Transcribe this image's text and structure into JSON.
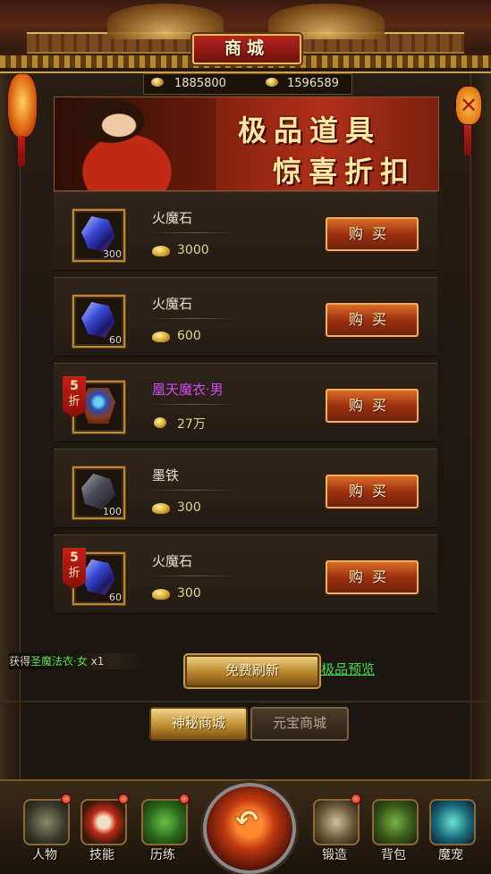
{
  "title": "商城",
  "currency": {
    "gold": "1885800",
    "yuanbao": "1596589"
  },
  "banner": {
    "line1": "极品道具",
    "line2": "惊喜折扣"
  },
  "items": [
    {
      "name": "火魔石",
      "qty": "300",
      "price": "3000",
      "buy_label": "购买",
      "discount": null,
      "icon": "blue-gem-icon"
    },
    {
      "name": "火魔石",
      "qty": "60",
      "price": "600",
      "buy_label": "购买",
      "discount": null,
      "icon": "blue-gem-icon"
    },
    {
      "name": "凰天魔衣·男",
      "qty": "",
      "price": "27万",
      "buy_label": "购买",
      "discount": {
        "num": "5",
        "unit": "折"
      },
      "icon": "armor-icon"
    },
    {
      "name": "墨铁",
      "qty": "100",
      "price": "300",
      "buy_label": "购买",
      "discount": null,
      "icon": "dark-iron-icon"
    },
    {
      "name": "火魔石",
      "qty": "60",
      "price": "300",
      "buy_label": "购买",
      "discount": {
        "num": "5",
        "unit": "折"
      },
      "icon": "blue-gem-icon"
    }
  ],
  "notice": {
    "prefix": "获得",
    "item": "圣魔法衣·女",
    "count": "x1"
  },
  "refresh_label": "免费刷新",
  "preview_label": "极品预览",
  "tabs": {
    "mystic": "神秘商城",
    "yuanbao": "元宝商城"
  },
  "nav": {
    "character": "人物",
    "skills": "技能",
    "training": "历练",
    "forge": "锻造",
    "bag": "背包",
    "pet": "魔宠"
  },
  "colors": {
    "accent_gold": "#e2bd5c",
    "buy_button": "#9c3310",
    "discount_red": "#c61e14",
    "purple_item": "#d24cf0",
    "green_link": "#41dd4a"
  }
}
